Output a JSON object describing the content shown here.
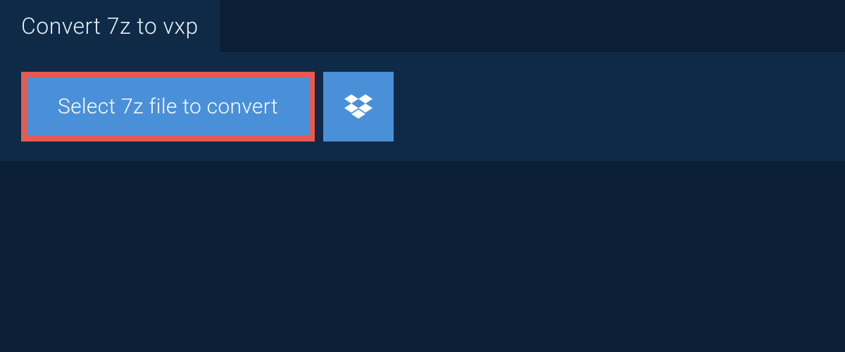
{
  "tab": {
    "title": "Convert 7z to vxp"
  },
  "panel": {
    "select_button_label": "Select 7z file to convert"
  },
  "colors": {
    "background": "#0a1f33",
    "panel": "#0e2a47",
    "button": "#4a90d9",
    "highlight_border": "#e85a4f",
    "text_light": "#ffffff",
    "text_tab": "#e8eef4"
  }
}
